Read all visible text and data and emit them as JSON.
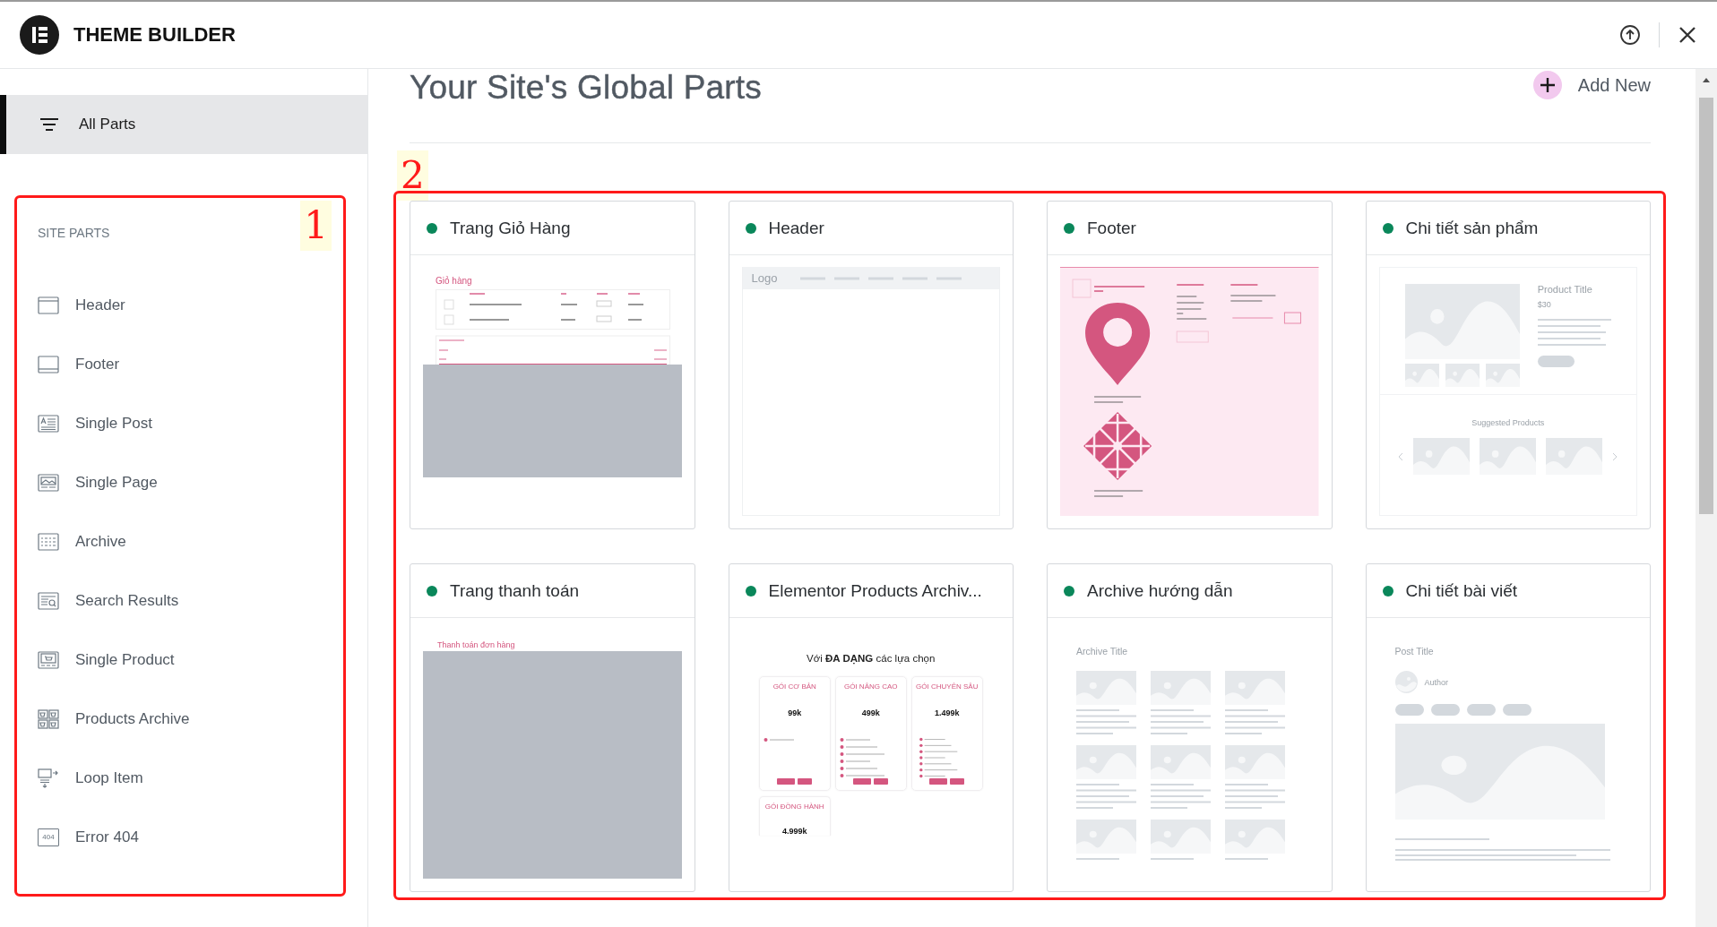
{
  "header": {
    "title": "THEME BUILDER"
  },
  "sidebar": {
    "all_parts": {
      "label": "All Parts",
      "selected": true
    },
    "section_title": "SITE PARTS",
    "items": [
      {
        "label": "Header",
        "kind": "header"
      },
      {
        "label": "Footer",
        "kind": "footer"
      },
      {
        "label": "Single Post",
        "kind": "post"
      },
      {
        "label": "Single Page",
        "kind": "page"
      },
      {
        "label": "Archive",
        "kind": "archive"
      },
      {
        "label": "Search Results",
        "kind": "search"
      },
      {
        "label": "Single Product",
        "kind": "product"
      },
      {
        "label": "Products Archive",
        "kind": "products"
      },
      {
        "label": "Loop Item",
        "kind": "loop"
      },
      {
        "label": "Error 404",
        "kind": "error",
        "badge": "404"
      }
    ]
  },
  "main": {
    "title": "Your Site's Global Parts",
    "add_button": "Add New",
    "cards": [
      {
        "title": "Trang Giỏ Hàng",
        "active": true,
        "preview": {
          "kind": "cart",
          "heading": "Giỏ hàng"
        }
      },
      {
        "title": "Header",
        "active": true,
        "preview": {
          "kind": "header",
          "logo": "Logo"
        }
      },
      {
        "title": "Footer",
        "active": true,
        "preview": {
          "kind": "footer"
        }
      },
      {
        "title": "Chi tiết sản phẩm",
        "active": true,
        "preview": {
          "kind": "product",
          "title": "Product Title",
          "price": "$30",
          "suggested": "Suggested Products"
        }
      },
      {
        "title": "Trang thanh toán",
        "active": true,
        "preview": {
          "kind": "checkout",
          "heading": "Thanh toán đơn hàng"
        }
      },
      {
        "title": "Elementor Products Archiv...",
        "active": true,
        "preview": {
          "kind": "pricing",
          "heading": "Với **ĐA DẠNG** các lựa chọn",
          "plans": [
            {
              "name": "GÓI CƠ BẢN",
              "price": "99k"
            },
            {
              "name": "GÓI NÂNG CAO",
              "price": "499k"
            },
            {
              "name": "GÓI CHUYÊN SÂU",
              "price": "1.499k"
            },
            {
              "name": "GÓI ĐỒNG HÀNH",
              "price": "4.999k"
            }
          ]
        }
      },
      {
        "title": "Archive hướng dẫn",
        "active": true,
        "preview": {
          "kind": "archive",
          "title": "Archive Title"
        }
      },
      {
        "title": "Chi tiết bài viết",
        "active": true,
        "preview": {
          "kind": "post",
          "title": "Post Title",
          "author": "Author"
        }
      }
    ]
  },
  "annotations": {
    "sidebar": "1",
    "cards": "2"
  }
}
